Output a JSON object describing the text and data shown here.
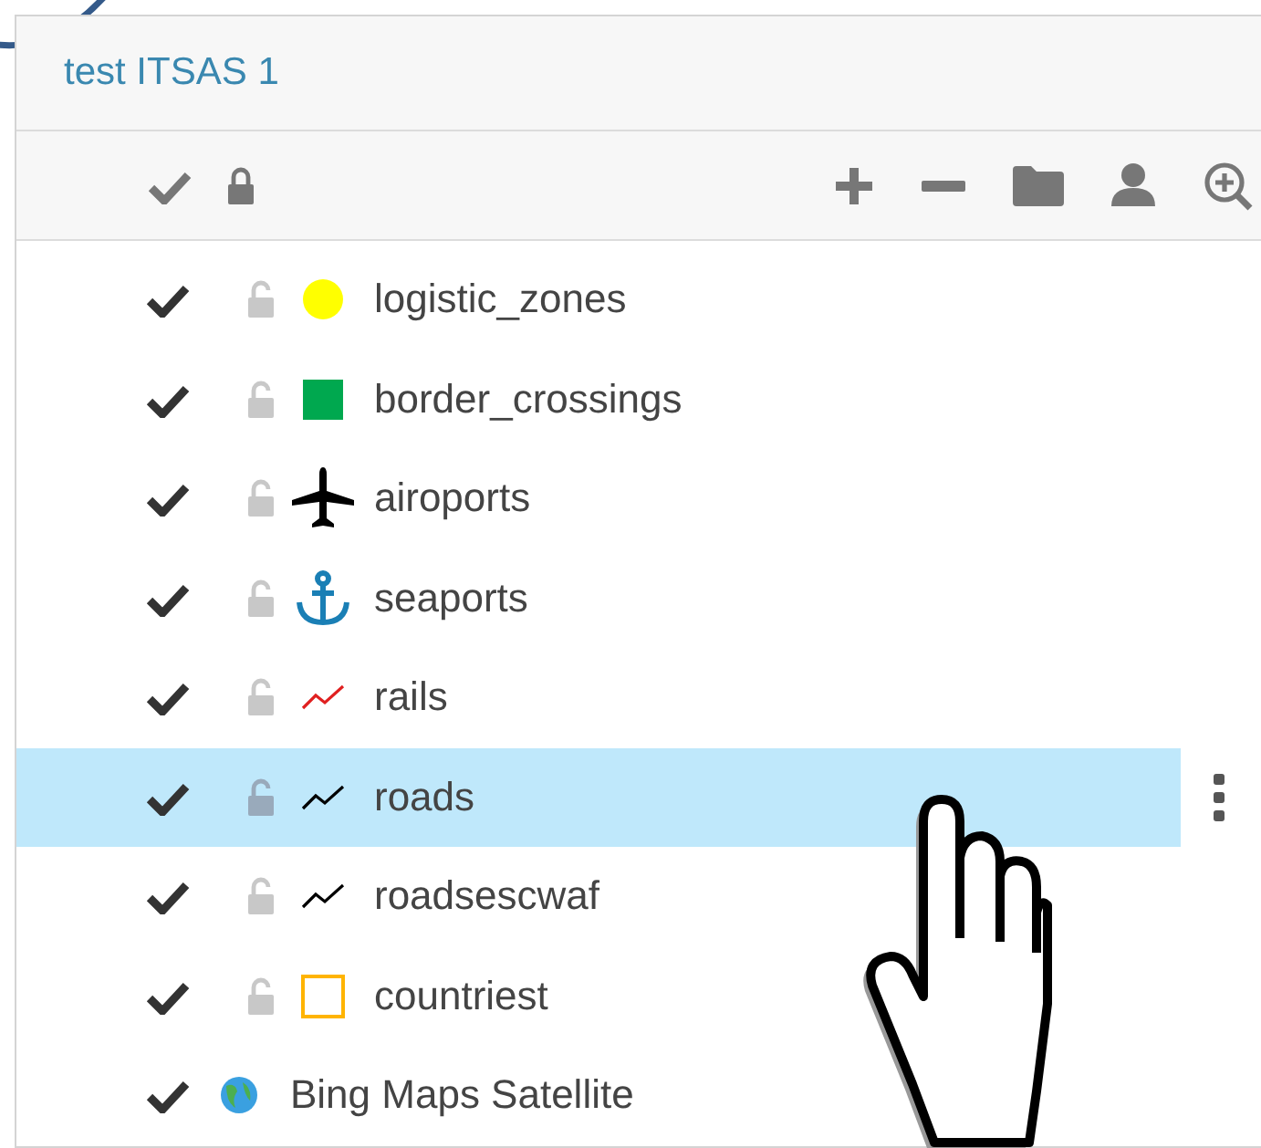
{
  "panel": {
    "title": "test ITSAS 1"
  },
  "toolbar": {
    "show_all_checked": true,
    "lock_all": true
  },
  "layers": [
    {
      "name": "logistic_zones",
      "visible": true,
      "locked": false,
      "selected": false,
      "symbol": {
        "kind": "circle",
        "color": "#ffff00"
      }
    },
    {
      "name": "border_crossings",
      "visible": true,
      "locked": false,
      "selected": false,
      "symbol": {
        "kind": "square",
        "color": "#00a84f"
      }
    },
    {
      "name": "airoports",
      "visible": true,
      "locked": false,
      "selected": false,
      "symbol": {
        "kind": "plane",
        "color": "#000000"
      }
    },
    {
      "name": "seaports",
      "visible": true,
      "locked": false,
      "selected": false,
      "symbol": {
        "kind": "anchor",
        "color": "#1a7fb5"
      }
    },
    {
      "name": "rails",
      "visible": true,
      "locked": false,
      "selected": false,
      "symbol": {
        "kind": "line",
        "color": "#e02020"
      }
    },
    {
      "name": "roads",
      "visible": true,
      "locked": false,
      "selected": true,
      "symbol": {
        "kind": "line",
        "color": "#000000"
      }
    },
    {
      "name": "roadsescwaf",
      "visible": true,
      "locked": false,
      "selected": false,
      "symbol": {
        "kind": "line",
        "color": "#000000"
      }
    },
    {
      "name": "countriest",
      "visible": true,
      "locked": false,
      "selected": false,
      "symbol": {
        "kind": "outline-square",
        "color": "#ffb400"
      }
    },
    {
      "name": "Bing Maps Satellite",
      "visible": true,
      "selected": false,
      "symbol": {
        "kind": "globe",
        "color": "#3aa0e0"
      }
    }
  ]
}
